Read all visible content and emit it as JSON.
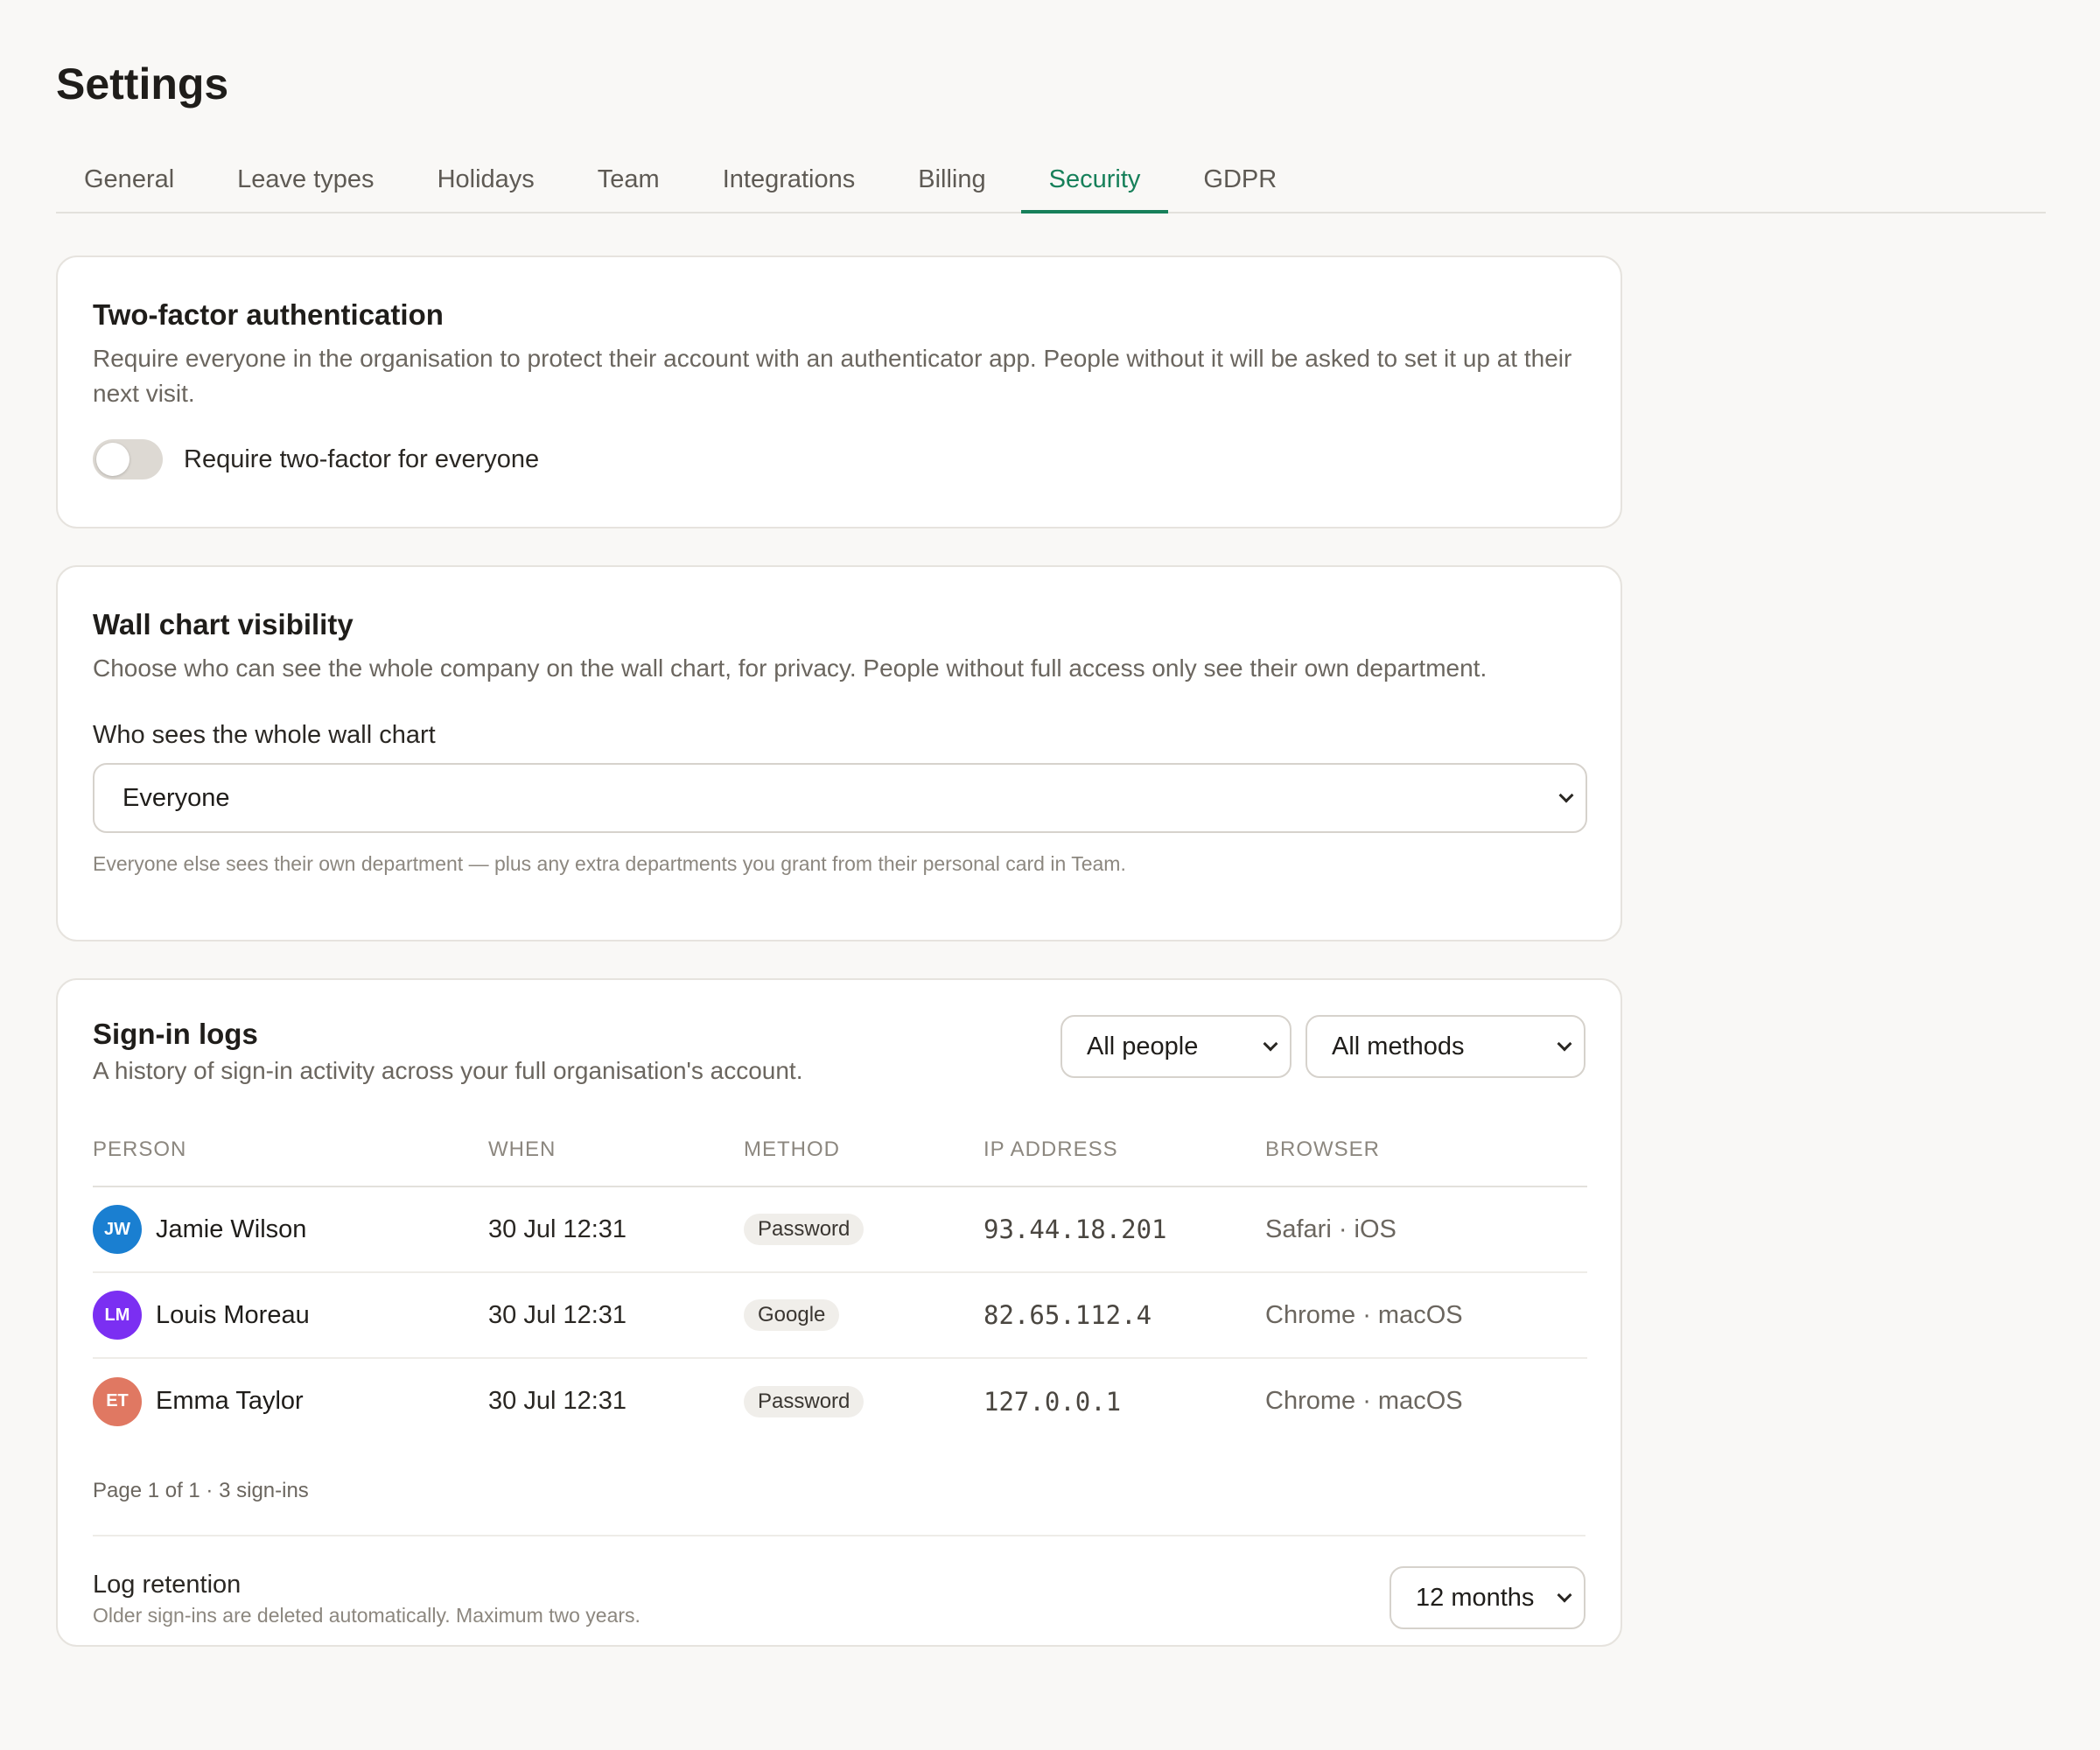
{
  "page": {
    "title": "Settings"
  },
  "tabs": [
    {
      "label": "General"
    },
    {
      "label": "Leave types"
    },
    {
      "label": "Holidays"
    },
    {
      "label": "Team"
    },
    {
      "label": "Integrations"
    },
    {
      "label": "Billing"
    },
    {
      "label": "Security",
      "active": true
    },
    {
      "label": "GDPR"
    }
  ],
  "two_factor": {
    "title": "Two-factor authentication",
    "description": "Require everyone in the organisation to protect their account with an authenticator app. People without it will be asked to set it up at their next visit.",
    "toggle_label": "Require two-factor for everyone",
    "enabled": false
  },
  "wall_chart": {
    "title": "Wall chart visibility",
    "description": "Choose who can see the whole company on the wall chart, for privacy. People without full access only see their own department.",
    "field_label": "Who sees the whole wall chart",
    "selected": "Everyone",
    "hint": "Everyone else sees their own department — plus any extra departments you grant from their personal card in Team."
  },
  "sign_in_logs": {
    "title": "Sign-in logs",
    "description": "A history of sign-in activity across your full organisation's account.",
    "filter_people": "All people",
    "filter_methods": "All methods",
    "columns": [
      "PERSON",
      "WHEN",
      "METHOD",
      "IP ADDRESS",
      "BROWSER"
    ],
    "rows": [
      {
        "initials": "JW",
        "name": "Jamie Wilson",
        "when": "30 Jul 12:31",
        "method": "Password",
        "ip": "93.44.18.201",
        "browser": "Safari · iOS",
        "avatar_color": "#1a7fd1"
      },
      {
        "initials": "LM",
        "name": "Louis Moreau",
        "when": "30 Jul 12:31",
        "method": "Google",
        "ip": "82.65.112.4",
        "browser": "Chrome · macOS",
        "avatar_color": "#7b2ff2"
      },
      {
        "initials": "ET",
        "name": "Emma Taylor",
        "when": "30 Jul 12:31",
        "method": "Password",
        "ip": "127.0.0.1",
        "browser": "Chrome · macOS",
        "avatar_color": "#e07862"
      }
    ],
    "pager": "Page 1 of 1 · 3 sign-ins",
    "retention_title": "Log retention",
    "retention_hint": "Older sign-ins are deleted automatically. Maximum two years.",
    "retention_value": "12 months"
  }
}
